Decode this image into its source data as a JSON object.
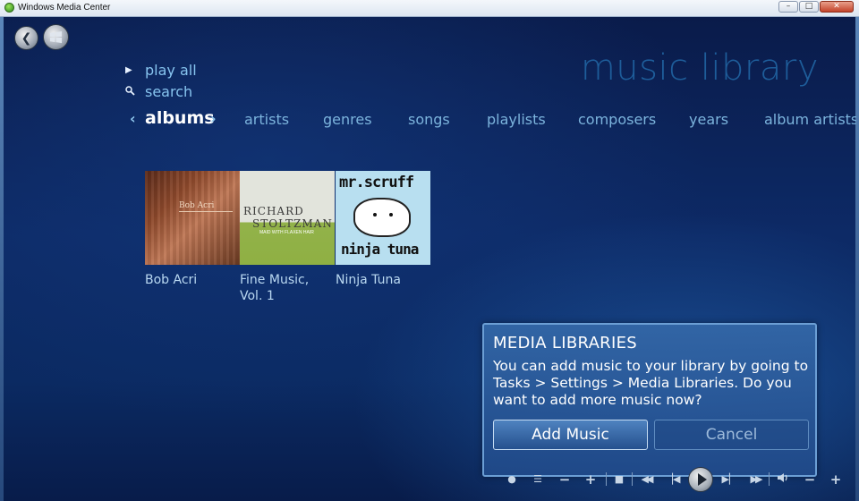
{
  "window": {
    "title": "Windows Media Center",
    "buttons": [
      "–",
      "□",
      "✕"
    ]
  },
  "nav": {
    "back_icon": "back-arrow-icon",
    "start_icon": "windows-logo-icon"
  },
  "page": {
    "title": "music library"
  },
  "menu": {
    "play_all": {
      "label": "play all",
      "icon": "play-icon"
    },
    "search": {
      "label": "search",
      "icon": "magnifier-icon"
    }
  },
  "tabs": {
    "prev_arrow": "‹",
    "next_arrow": "›",
    "active": "albums",
    "items": [
      "artists",
      "genres",
      "songs",
      "playlists",
      "composers",
      "years",
      "album artists"
    ]
  },
  "albums": [
    {
      "title": "Bob Acri",
      "cover_text": "Bob Acri"
    },
    {
      "title": "Fine Music, Vol. 1",
      "title_line1": "Fine Music,",
      "title_line2": "Vol. 1",
      "cover_name_line1": "RICHARD",
      "cover_name_line2": "STOLTZMAN",
      "cover_subtitle": "MAID WITH FLAXEN HAIR"
    },
    {
      "title": "Ninja Tuna",
      "cover_top": "mr.scruff",
      "cover_bottom": "ninja tuna"
    }
  ],
  "dialog": {
    "title": "MEDIA LIBRARIES",
    "message": "You can add music to your library by going to Tasks > Settings > Media Libraries. Do you want to add more music now?",
    "primary_button": "Add Music",
    "secondary_button": "Cancel"
  },
  "transport": {
    "controls": [
      "record",
      "guide",
      "channel-down",
      "channel-up",
      "stop",
      "rewind",
      "previous",
      "play",
      "next",
      "fast-forward",
      "mute",
      "volume-down",
      "volume-up"
    ]
  },
  "colors": {
    "accent": "#1e5d9a",
    "background": "#0a1a44",
    "dialog": "#2f62a4"
  }
}
